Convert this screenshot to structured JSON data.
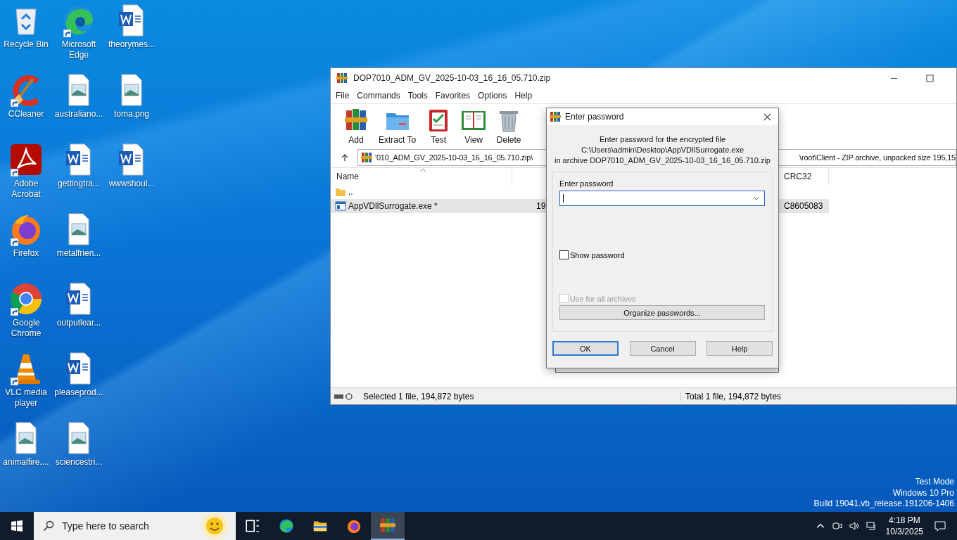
{
  "desktop": {
    "icons": [
      {
        "label": "Recycle Bin",
        "kind": "recycle",
        "shortcut": false
      },
      {
        "label": "CCleaner",
        "kind": "ccleaner",
        "shortcut": true
      },
      {
        "label": "Adobe Acrobat",
        "kind": "acrobat",
        "shortcut": true
      },
      {
        "label": "Firefox",
        "kind": "firefox",
        "shortcut": true
      },
      {
        "label": "Google Chrome",
        "kind": "chrome",
        "shortcut": true
      },
      {
        "label": "VLC media player",
        "kind": "vlc",
        "shortcut": true
      },
      {
        "label": "animalfire....",
        "kind": "image",
        "shortcut": false
      },
      {
        "label": "Microsoft Edge",
        "kind": "edge",
        "shortcut": true
      },
      {
        "label": "australiano...",
        "kind": "image",
        "shortcut": false
      },
      {
        "label": "gettingtra...",
        "kind": "word",
        "shortcut": false
      },
      {
        "label": "metalfrien...",
        "kind": "image",
        "shortcut": false
      },
      {
        "label": "outputlear...",
        "kind": "word",
        "shortcut": false
      },
      {
        "label": "pleaseprod...",
        "kind": "word",
        "shortcut": false
      },
      {
        "label": "sciencestri...",
        "kind": "image",
        "shortcut": false
      },
      {
        "label": "theorymes...",
        "kind": "word",
        "shortcut": false
      },
      {
        "label": "toma.png",
        "kind": "image",
        "shortcut": false
      },
      {
        "label": "wwwshoul...",
        "kind": "word",
        "shortcut": false
      }
    ]
  },
  "window": {
    "title": "DOP7010_ADM_GV_2025-10-03_16_16_05.710.zip",
    "menu": [
      "File",
      "Commands",
      "Tools",
      "Favorites",
      "Options",
      "Help"
    ],
    "toolbar": [
      {
        "label": "Add",
        "kind": "add"
      },
      {
        "label": "Extract To",
        "kind": "extract"
      },
      {
        "label": "Test",
        "kind": "test"
      },
      {
        "label": "View",
        "kind": "view"
      },
      {
        "label": "Delete",
        "kind": "delete"
      }
    ],
    "address": [
      "'010_ADM_GV_2025-10-03_16_16_05.710.zip\\",
      "\\root\\Client - ZIP archive, unpacked size 195,15"
    ],
    "columns": [
      "Name",
      "CRC32"
    ],
    "rows": [
      {
        "name": "..",
        "kind": "up",
        "selected": false
      },
      {
        "name": "AppVDllSurrogate.exe *",
        "kind": "exe",
        "size": "19",
        "crc": "C8605083",
        "selected": true
      }
    ],
    "status": [
      "Selected 1 file, 194,872 bytes",
      "Total 1 file, 194,872 bytes"
    ]
  },
  "dialog": {
    "title": "Enter password",
    "message": [
      "Enter password for the encrypted file",
      "C:\\Users\\admin\\Desktop\\AppVDllSurrogate.exe",
      "in archive DOP7010_ADM_GV_2025-10-03_16_16_05.710.zip"
    ],
    "field_label": "Enter password",
    "show_password": {
      "label": "Show password",
      "checked": false,
      "disabled": false
    },
    "use_all": {
      "label": "Use for all archives",
      "checked": false,
      "disabled": true
    },
    "organize": "Organize passwords...",
    "buttons": [
      {
        "label": "OK",
        "default": true
      },
      {
        "label": "Cancel",
        "default": false
      },
      {
        "label": "Help",
        "default": false
      }
    ]
  },
  "system_notice": [
    "Test Mode",
    "Windows 10 Pro",
    "Build 19041.vb_release.191206-1406"
  ],
  "taskbar": {
    "search": {
      "placeholder": "Type here to search"
    },
    "apps": [
      {
        "kind": "taskview",
        "active": false
      },
      {
        "kind": "edge",
        "active": false
      },
      {
        "kind": "explorer",
        "active": false
      },
      {
        "kind": "firefox",
        "active": false
      },
      {
        "kind": "winrar",
        "active": true
      }
    ],
    "time": "4:18 PM",
    "date": "10/3/2025"
  }
}
